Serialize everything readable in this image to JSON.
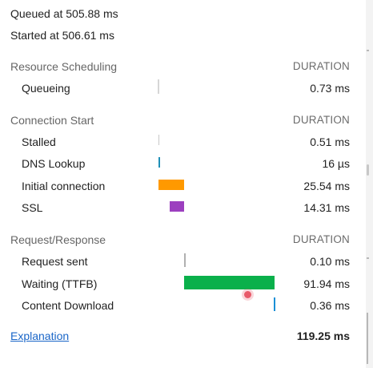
{
  "queued_text": "Queued at 505.88 ms",
  "started_text": "Started at 506.61 ms",
  "sections": {
    "resource_scheduling": "Resource Scheduling",
    "connection_start": "Connection Start",
    "request_response": "Request/Response"
  },
  "duration_header": "DURATION",
  "rows": {
    "queueing": {
      "label": "Queueing",
      "value": "0.73 ms",
      "color": "#d6d6d6"
    },
    "stalled": {
      "label": "Stalled",
      "value": "0.51 ms",
      "color": "#c8c8c8"
    },
    "dns_lookup": {
      "label": "DNS Lookup",
      "value": "16 µs",
      "color": "#1f8fb7"
    },
    "initial_connection": {
      "label": "Initial connection",
      "value": "25.54 ms",
      "color": "#ff9900"
    },
    "ssl": {
      "label": "SSL",
      "value": "14.31 ms",
      "color": "#9c3fbf"
    },
    "request_sent": {
      "label": "Request sent",
      "value": "0.10 ms",
      "color": "#b0b0b0"
    },
    "waiting_ttfb": {
      "label": "Waiting (TTFB)",
      "value": "91.94 ms",
      "color": "#0ab04b"
    },
    "content_download": {
      "label": "Content Download",
      "value": "0.36 ms",
      "color": "#1a8fd6"
    }
  },
  "explanation_link": "Explanation",
  "total": "119.25 ms",
  "colors": {
    "link": "#1a66c8",
    "section_text": "#666666"
  }
}
